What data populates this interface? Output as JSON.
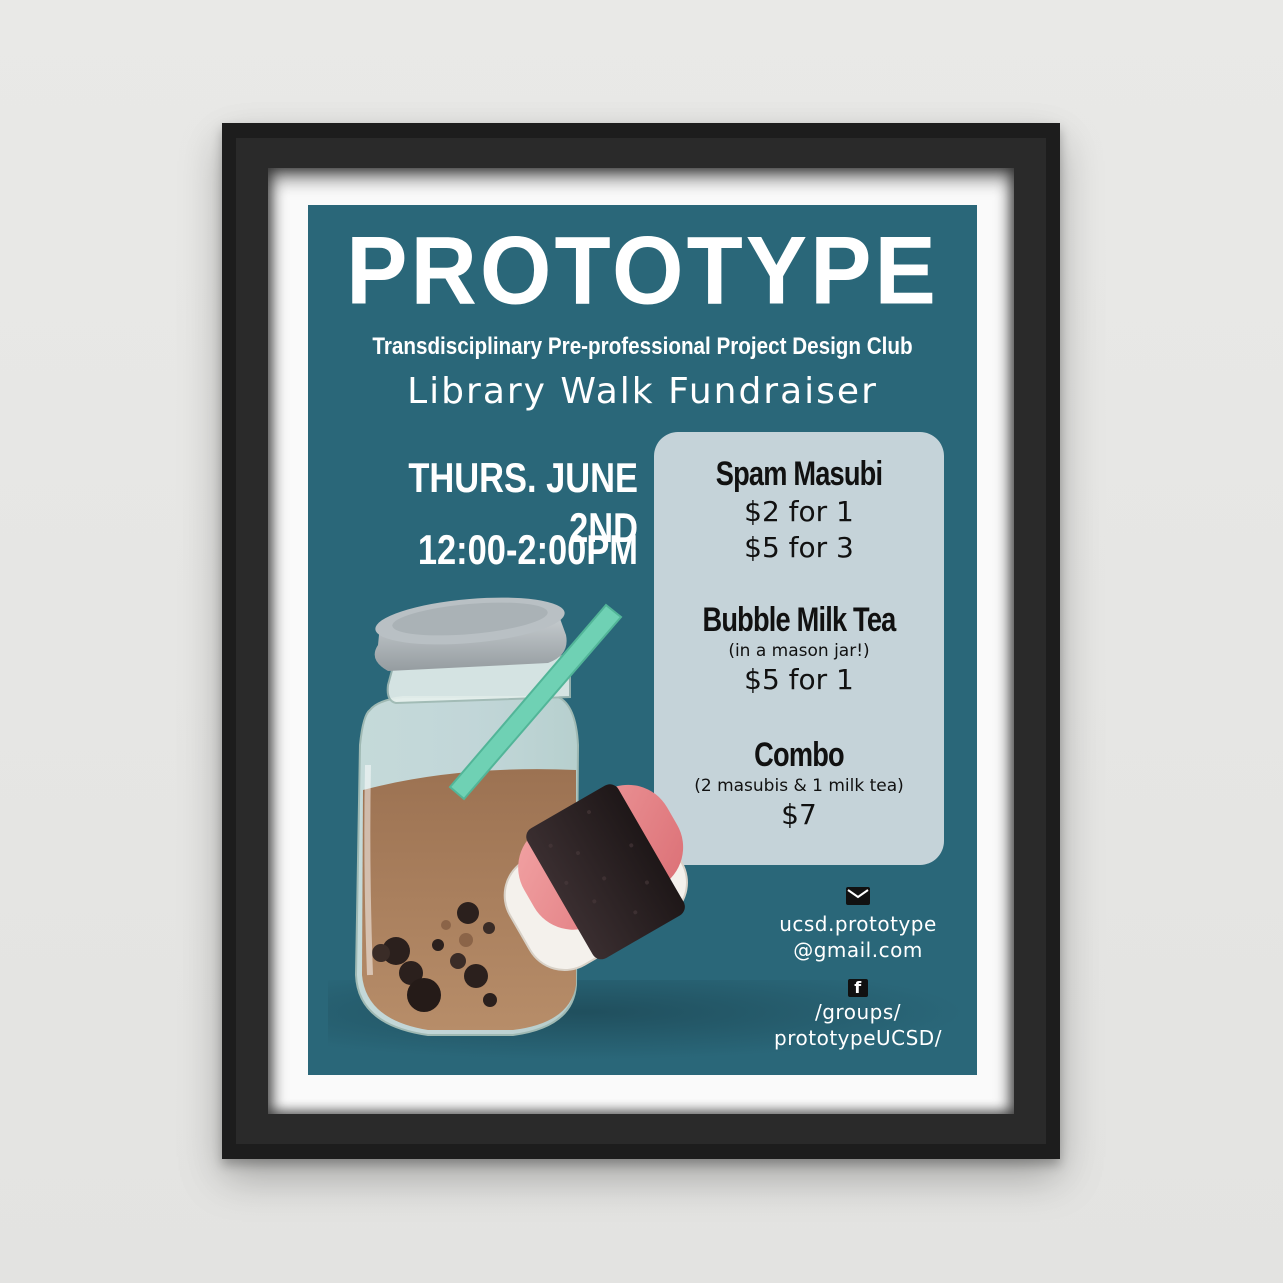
{
  "poster": {
    "title": "PROTOTYPE",
    "subtitle": "Transdisciplinary Pre-professional Project Design Club",
    "event": "Library Walk Fundraiser",
    "date": "THURS. JUNE 2ND",
    "time": "12:00-2:00PM",
    "menu": {
      "spam": {
        "name": "Spam Masubi",
        "price_1": "$2 for 1",
        "price_2": "$5 for 3"
      },
      "tea": {
        "name": "Bubble Milk Tea",
        "note": "(in a mason jar!)",
        "price": "$5 for 1"
      },
      "combo": {
        "name": "Combo",
        "note": "(2 masubis & 1 milk tea)",
        "price": "$7"
      }
    },
    "contact": {
      "email_icon": "mail-icon",
      "email_line_1": "ucsd.prototype",
      "email_line_2": "@gmail.com",
      "facebook_icon": "facebook-icon",
      "facebook_icon_letter": "f",
      "facebook_line_1": "/groups/",
      "facebook_line_2": "prototypeUCSD/"
    }
  },
  "colors": {
    "wall": "#e6e6e4",
    "frame": "#1d1d1d",
    "mat": "#fafafa",
    "poster_background": "#2a6779",
    "menu_panel": "#c5d3d9",
    "straw": "#6fd1b4",
    "tea": "#a57a57",
    "spam": "#e9868a",
    "nori": "#2b2224"
  }
}
